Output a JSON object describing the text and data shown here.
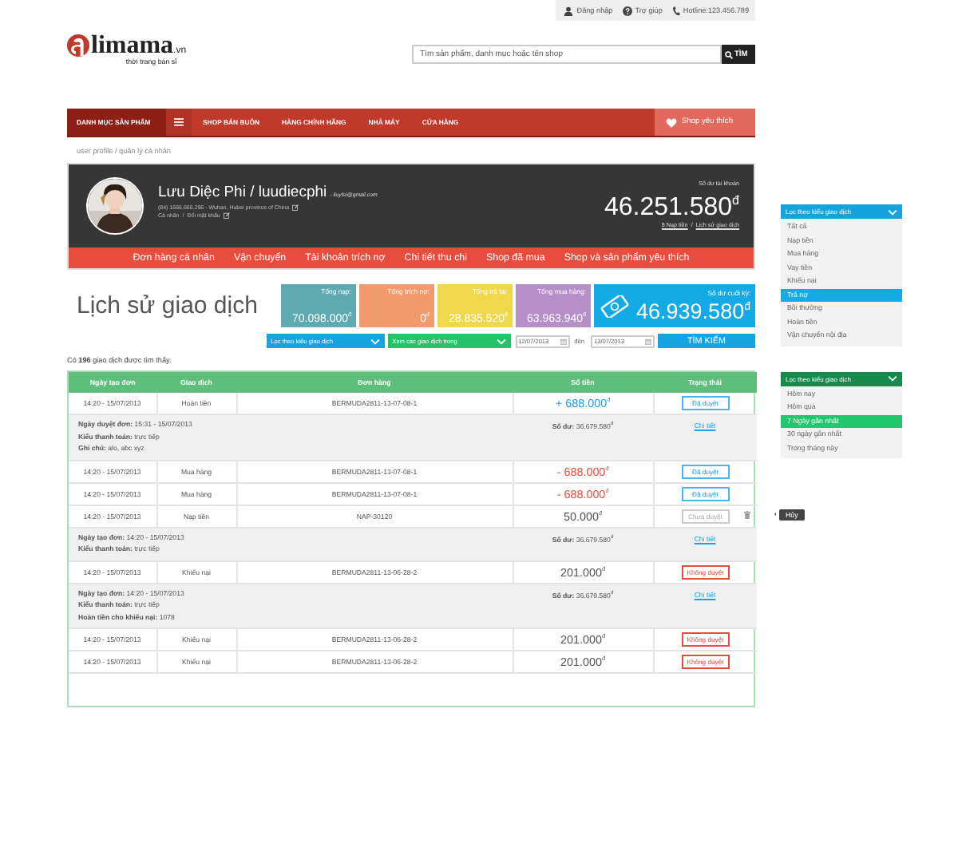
{
  "top_bar": [
    {
      "kind": "user",
      "label": "Đăng nhập"
    },
    {
      "kind": "help",
      "label": "Trợ giúp"
    },
    {
      "kind": "phone",
      "label": "Hotline:123.456.789"
    }
  ],
  "logo": {
    "mark": "limama",
    "suffix": ".vn",
    "tagline": "thời trang bán sỉ"
  },
  "search": {
    "placeholder": "Tìm sản phẩm, danh mục hoặc tên shop",
    "button": "TÌM"
  },
  "nav": {
    "category": "DANH MỤC SẢN PHẨM",
    "items": [
      "SHOP BÁN BUÔN",
      "HÀNG CHÍNH HÃNG",
      "NHÀ MÁY",
      "CỬA HÀNG"
    ],
    "favorite": "Shop yêu thích"
  },
  "breadcrumb": "user profile / quản lý cá nhân",
  "profile": {
    "name": "Lưu Diệc Phi / luudiecphi",
    "email": "- liuyfei@gmail.com",
    "contact": "(84) 1666.666.296 - Wuhan, Hubei province of China",
    "links": [
      "Cá nhân",
      "Đổi mật khẩu"
    ],
    "link_separator": "/",
    "balance_label": "Số dư tài khoản",
    "balance": "46.251.580$^{đ}$",
    "deposit": "$ Nạp tiền",
    "links_separator2": "/",
    "history": "Lịch sử giao dịch"
  },
  "tabs": [
    "Đơn hàng cá nhân",
    "Vận chuyển",
    "Tài khoản trích nợ",
    "Chi tiết thu chi",
    "Shop đã mua",
    "Shop và sản phẩm yêu thích"
  ],
  "history": {
    "title": "Lịch sử giao dịch",
    "stats": [
      {
        "label": "Tổng nạp:",
        "value": "70.098.000$^{đ}$",
        "color": "#5fa9b1"
      },
      {
        "label": "Tổng trích nợ:",
        "value": "0$^{đ}$",
        "color": "#f39a6c"
      },
      {
        "label": "Tổng trả lại:",
        "value": "28.835.520$^{đ}$",
        "color": "#efd84c"
      },
      {
        "label": "Tổng mua hàng:",
        "value": "63.963.940$^{đ}$",
        "color": "#b58fc6"
      }
    ],
    "final": {
      "label": "Số dư cuối kỳ:",
      "value": "46.939.580$^{đ}$"
    },
    "filters": {
      "type_dropdown": "Lọc theo kiểu giao dịch",
      "period_dropdown": "Xem các giao dịch trong",
      "from": "12/07/2013",
      "to_label": "đến",
      "to": "13/07/2013",
      "button": "TÌM KIẾM"
    },
    "result": "Có **196** giao dịch được tìm thấy."
  },
  "table": {
    "columns": [
      "Ngày tạo đơn",
      "Giao dịch",
      "Đơn hàng",
      "Số tiền",
      "Trạng thái"
    ],
    "rows": [
      {
        "kind": "main",
        "date": "14:20 - 15/07/2013",
        "type": "Hoàn tiền",
        "order": "BERMUDA2811-13-07-08-1",
        "amount": {
          "value": "+ 688.000$^{đ}$",
          "kind": "in"
        },
        "status": {
          "label": "Đã duyệt",
          "kind": "approved"
        },
        "deletable": false
      },
      {
        "kind": "detail",
        "lines": [
          "**Ngày duyệt đơn:** 15:31 - 15/07/2013",
          "**Kiểu thanh toán:** trực tiếp",
          "**Ghi chú:** alo, abc xyz"
        ],
        "balance": "**Số dư:** 36.679.580$^{đ}$",
        "link": "Chi tiết"
      },
      {
        "kind": "main",
        "date": "14:20 - 15/07/2013",
        "type": "Mua hàng",
        "order": "BERMUDA2811-13-07-08-1",
        "amount": {
          "value": "- 688.000$^{đ}$",
          "kind": "out"
        },
        "status": {
          "label": "Đã duyệt",
          "kind": "approved"
        },
        "deletable": false
      },
      {
        "kind": "main",
        "date": "14:20 - 15/07/2013",
        "type": "Mua hàng",
        "order": "BERMUDA2811-13-07-08-1",
        "amount": {
          "value": "- 688.000$^{đ}$",
          "kind": "out"
        },
        "status": {
          "label": "Đã duyệt",
          "kind": "approved"
        },
        "deletable": false
      },
      {
        "kind": "main",
        "date": "14:20 - 15/07/2013",
        "type": "Nạp tiền",
        "order": "NAP-30120",
        "amount": {
          "value": "50.000$^{đ}$",
          "kind": "neutral"
        },
        "status": {
          "label": "Chưa duyệt",
          "kind": "pending"
        },
        "deletable": true,
        "delete_tooltip": "Hủy"
      },
      {
        "kind": "detail",
        "lines": [
          "**Ngày tạo đơn:** 14:20 - 15/07/2013",
          "**Kiểu thanh toán:** trực tiếp"
        ],
        "balance": "**Số dư:** 36.679.580$^{đ}$",
        "link": "Chi tiết"
      },
      {
        "kind": "main",
        "date": "14:20 - 15/07/2013",
        "type": "Khiếu nại",
        "order": "BERMUDA2811-13-06-28-2",
        "amount": {
          "value": "201.000$^{đ}$",
          "kind": "neutral"
        },
        "status": {
          "label": "Không duyệt",
          "kind": "rejected"
        },
        "deletable": false
      },
      {
        "kind": "detail",
        "lines": [
          "**Ngày tạo đơn:** 14:20 - 15/07/2013",
          "**Kiểu thanh toán:** trực tiếp",
          "**Hoàn tiền cho khiếu nại:** 1078"
        ],
        "balance": "**Số dư:** 36.679.580$^{đ}$",
        "link": "Chi tiết"
      },
      {
        "kind": "main",
        "date": "14:20 - 15/07/2013",
        "type": "Khiếu nại",
        "order": "BERMUDA2811-13-06-28-2",
        "amount": {
          "value": "201.000$^{đ}$",
          "kind": "neutral"
        },
        "status": {
          "label": "Không duyệt",
          "kind": "rejected"
        },
        "deletable": false
      },
      {
        "kind": "main",
        "date": "14:20 - 15/07/2013",
        "type": "Khiếu nại",
        "order": "BERMUDA2811-13-06-28-2",
        "amount": {
          "value": "201.000$^{đ}$",
          "kind": "neutral"
        },
        "status": {
          "label": "Không duyệt",
          "kind": "rejected"
        },
        "deletable": false
      }
    ]
  },
  "panels": [
    {
      "kind": "type",
      "title": "Lọc theo kiểu giao dịch",
      "options": [
        {
          "label": "Tất cả",
          "selected": false
        },
        {
          "label": "Nạp tiền",
          "selected": false
        },
        {
          "label": "Mua hàng",
          "selected": false
        },
        {
          "label": "Vay tiền",
          "selected": false
        },
        {
          "label": "Khiếu nại",
          "selected": false
        },
        {
          "label": "Trả nợ",
          "selected": true
        },
        {
          "label": "Bồi thường",
          "selected": false
        },
        {
          "label": "Hoàn tiền",
          "selected": false
        },
        {
          "label": "Vận chuyển nội địa",
          "selected": false
        }
      ]
    },
    {
      "kind": "period",
      "title": "Lọc theo kiểu giao dịch",
      "options": [
        {
          "label": "Hôm nay",
          "selected": false
        },
        {
          "label": "Hôm qua",
          "selected": false
        },
        {
          "label": "7 Ngày gần nhất",
          "selected": true
        },
        {
          "label": "30 ngày gần nhất",
          "selected": false
        },
        {
          "label": "Trong tháng này",
          "selected": false
        }
      ]
    }
  ]
}
